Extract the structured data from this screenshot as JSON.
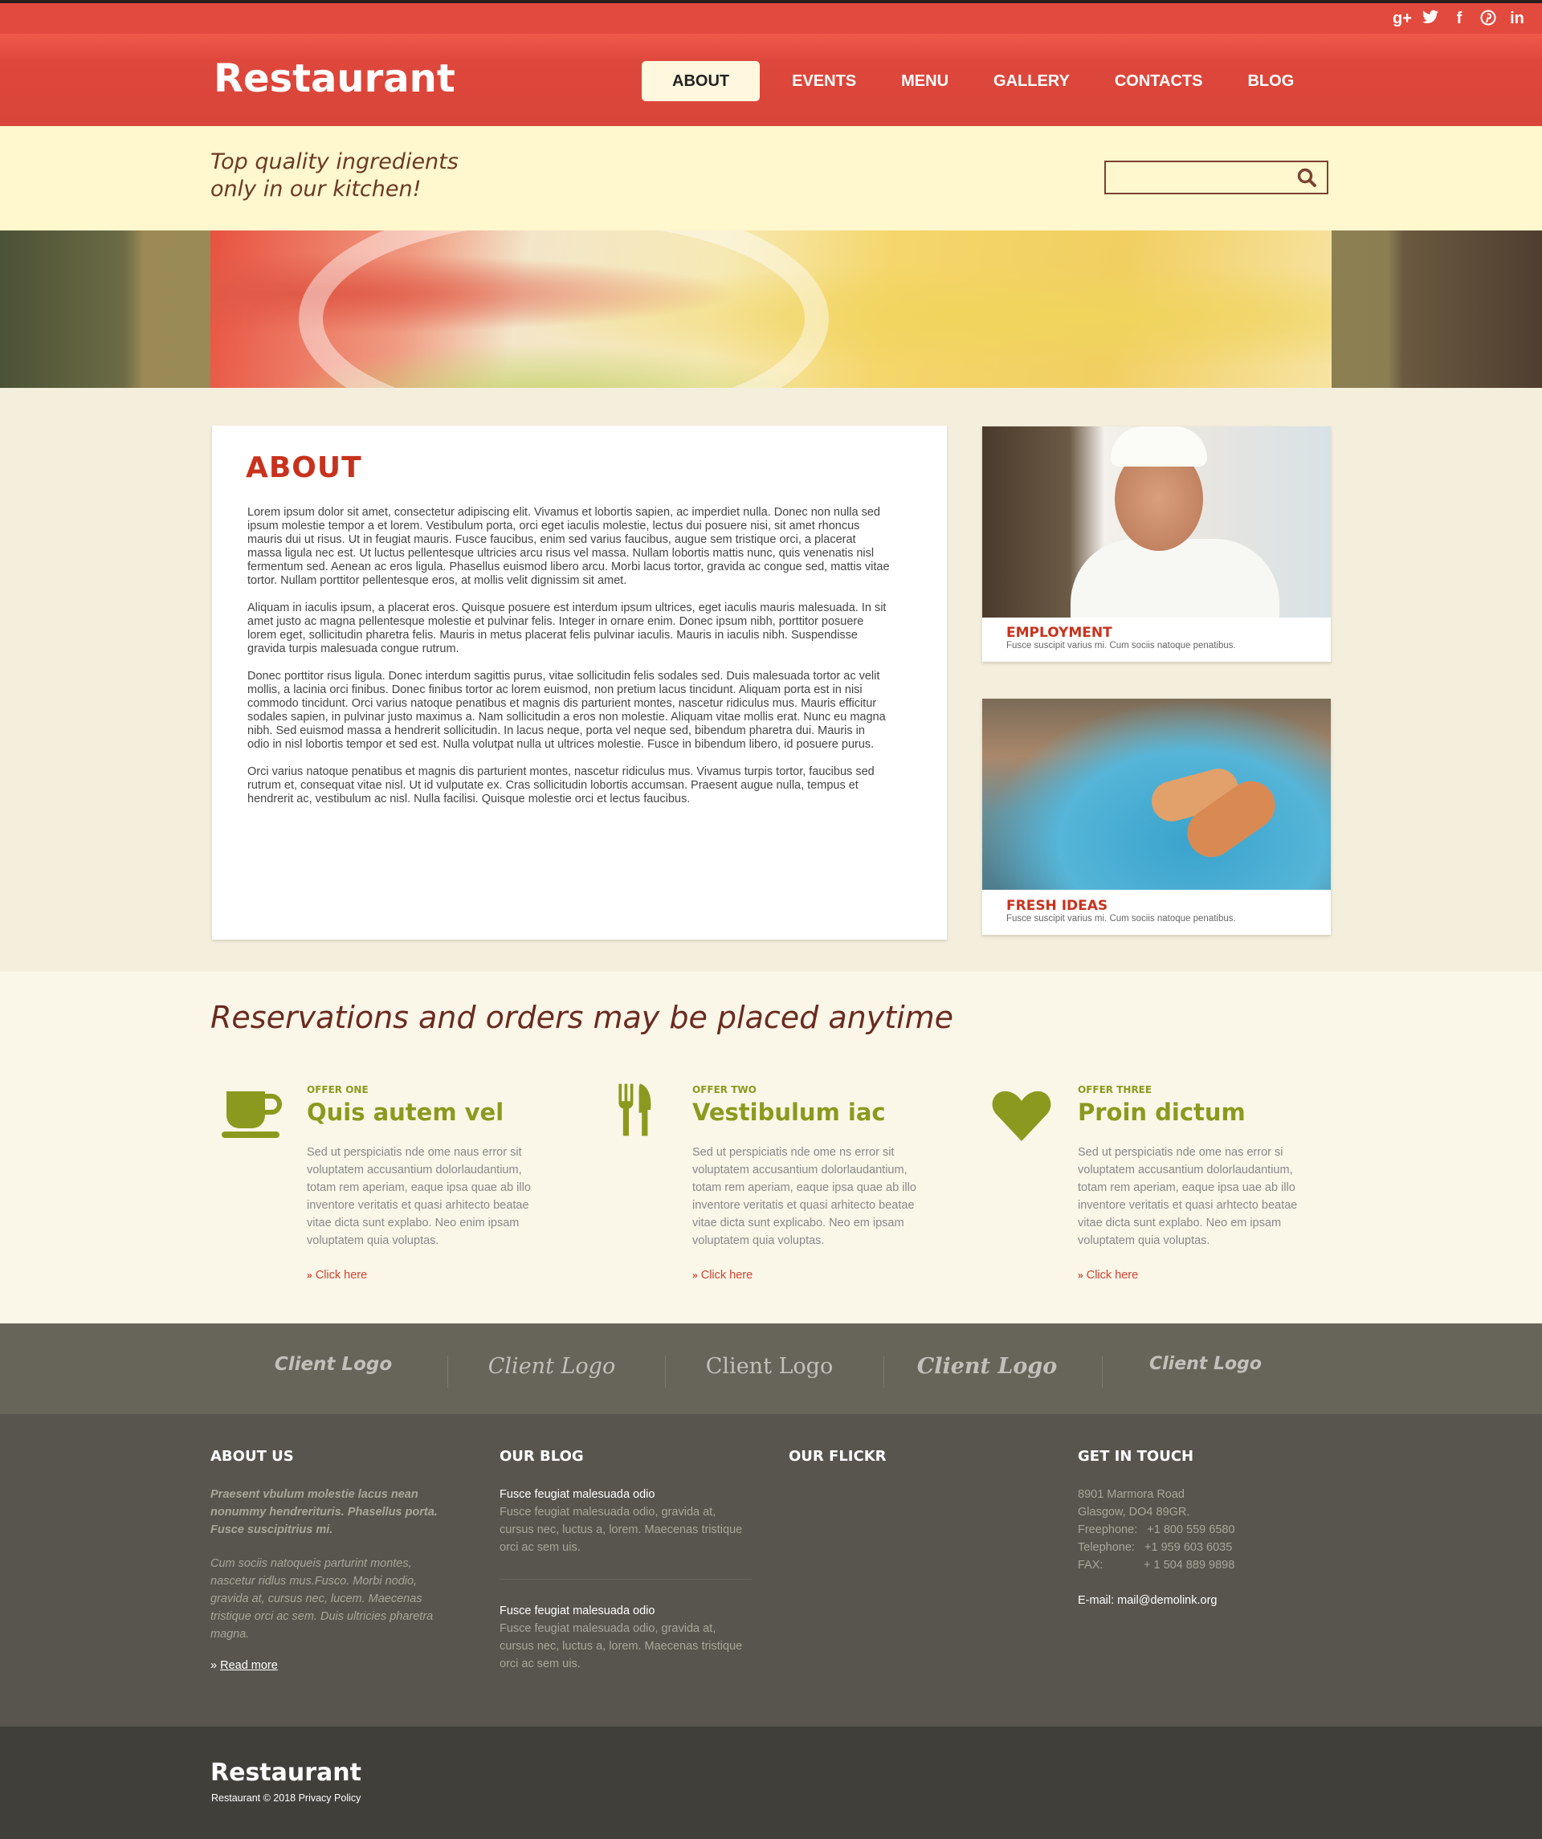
{
  "social": {
    "icons": [
      "google-plus-icon",
      "twitter-icon",
      "facebook-icon",
      "pinterest-icon",
      "linkedin-icon"
    ],
    "glyphs": [
      "g+",
      "t",
      "f",
      "p",
      "in"
    ]
  },
  "brand": {
    "logo": "Restaurant"
  },
  "nav": {
    "items": [
      "ABOUT",
      "EVENTS",
      "MENU",
      "GALLERY",
      "CONTACTS",
      "BLOG"
    ],
    "active": "ABOUT"
  },
  "tagline": {
    "line1": "Top quality ingredients",
    "line2": "only in our kitchen!"
  },
  "search": {
    "placeholder": "",
    "value": "",
    "icon": "search-icon"
  },
  "about": {
    "title": "ABOUT",
    "paragraphs": [
      "Lorem ipsum dolor sit amet, consectetur adipiscing elit. Vivamus et lobortis sapien, ac imperdiet nulla. Donec non nulla sed ipsum molestie tempor a et lorem. Vestibulum porta, orci eget iaculis molestie, lectus dui posuere nisi, sit amet rhoncus mauris dui ut risus. Ut in feugiat mauris. Fusce faucibus, enim sed varius faucibus, augue sem tristique orci, a placerat massa ligula nec est. Ut luctus pellentesque ultricies arcu risus vel massa. Nullam lobortis mattis nunc, quis venenatis nisl fermentum sed. Aenean ac eros ligula. Phasellus euismod libero arcu. Morbi lacus tortor, gravida ac congue sed, mattis vitae tortor. Nullam porttitor pellentesque eros, at mollis velit dignissim sit amet.",
      "Aliquam in iaculis ipsum, a placerat eros. Quisque posuere est interdum ipsum ultrices, eget iaculis mauris malesuada. In sit amet justo ac magna pellentesque molestie et pulvinar felis. Integer in ornare enim. Donec ipsum nibh, porttitor posuere lorem eget, sollicitudin pharetra felis. Mauris in metus placerat felis pulvinar iaculis. Mauris in iaculis nibh. Suspendisse gravida turpis malesuada congue rutrum.",
      "Donec porttitor risus ligula. Donec interdum sagittis purus, vitae sollicitudin felis sodales sed. Duis malesuada tortor ac velit mollis, a lacinia orci finibus. Donec finibus tortor ac lorem euismod, non pretium lacus tincidunt. Aliquam porta est in nisi commodo tincidunt. Orci varius natoque penatibus et magnis dis parturient montes, nascetur ridiculus mus. Mauris efficitur sodales sapien, in pulvinar justo maximus a. Nam sollicitudin a eros non molestie. Aliquam vitae mollis erat. Nunc eu magna nibh. Sed euismod massa a hendrerit sollicitudin. In lacus neque, porta vel neque sed, bibendum pharetra dui. Mauris in odio in nisl lobortis tempor et sed est. Nulla volutpat nulla ut ultrices molestie. Fusce in bibendum libero, id posuere purus.",
      "Orci varius natoque penatibus et magnis dis parturient montes, nascetur ridiculus mus. Vivamus turpis tortor, faucibus sed rutrum et, consequat vitae nisl. Ut id vulputate ex. Cras sollicitudin lobortis accumsan. Praesent augue nulla, tempus et hendrerit ac, vestibulum ac nisl. Nulla facilisi. Quisque molestie orci et lectus faucibus."
    ]
  },
  "side_cards": [
    {
      "title": "EMPLOYMENT",
      "text": "Fusce suscipit varius mi. Cum sociis natoque penatibus."
    },
    {
      "title": "FRESH IDEAS",
      "text": "Fusce suscipit varius mi. Cum sociis natoque penatibus."
    }
  ],
  "reservations": {
    "title": "Reservations and orders may be placed anytime",
    "offers": [
      {
        "kicker": "OFFER ONE",
        "title": "Quis autem vel",
        "icon": "coffee-cup-icon",
        "text": "Sed ut perspiciatis nde ome naus error sit voluptatem accusantium dolorlaudantium, totam rem aperiam, eaque ipsa quae ab illo inventore veritatis et quasi arhitecto beatae vitae dicta sunt explabo. Neo enim ipsam voluptatem quia voluptas.",
        "link": "Click here"
      },
      {
        "kicker": "OFFER TWO",
        "title": "Vestibulum iac",
        "icon": "fork-knife-icon",
        "text": "Sed ut perspiciatis nde ome ns error sit voluptatem accusantium dolorlaudantium, totam rem aperiam, eaque ipsa quae ab illo inventore veritatis et quasi arhitecto beatae vitae dicta sunt explicabo. Neo em ipsam voluptatem quia voluptas.",
        "link": "Click here"
      },
      {
        "kicker": "OFFER THREE",
        "title": "Proin dictum",
        "icon": "heart-icon",
        "text": "Sed ut perspiciatis nde ome nas error si voluptatem accusantium dolorlaudantium, totam rem aperiam, eaque ipsa uae ab illo inventore veritatis et quasi arhtecto beatae vitae dicta sunt explabo. Neo em ipsam voluptatem quia voluptas.",
        "link": "Click here"
      }
    ]
  },
  "clients": [
    "Client Logo",
    "Client Logo",
    "Client Logo",
    "Client Logo",
    "Client Logo"
  ],
  "footer": {
    "about": {
      "title": "ABOUT US",
      "lead": "Praesent vbulum molestie lacus nean nonummy hendrerituris. Phasellus porta. Fusce suscipitrius mi.",
      "text": "Cum sociis natoqueis parturint montes, nascetur ridlus mus.Fusco. Morbi nodio, gravida at, cursus nec, lucem. Maecenas tristique orci ac sem. Duis ultricies pharetra magna.",
      "link": "Read more"
    },
    "blog": {
      "title": "OUR BLOG",
      "posts": [
        {
          "title": "Fusce feugiat malesuada odio",
          "text": "Fusce feugiat malesuada odio, gravida at, cursus nec, luctus a, lorem. Maecenas tristique orci ac sem uis."
        },
        {
          "title": "Fusce feugiat malesuada odio",
          "text": "Fusce feugiat malesuada odio, gravida at, cursus nec, luctus a, lorem. Maecenas tristique orci ac sem uis."
        }
      ]
    },
    "flickr": {
      "title": "OUR FLICKR"
    },
    "contact": {
      "title": "GET IN TOUCH",
      "address1": "8901 Marmora Road",
      "address2": "Glasgow, DO4 89GR.",
      "freephone_label": "Freephone:",
      "freephone": "+1 800 559 6580",
      "telephone_label": "Telephone:",
      "telephone": "+1 959 603 6035",
      "fax_label": "FAX:",
      "fax": "+ 1 504 889 9898",
      "email_label": "E-mail:",
      "email": "mail@demolink.org"
    }
  },
  "bottom": {
    "logo": "Restaurant",
    "copyright": "Restaurant © 2018 Privacy Policy"
  },
  "colors": {
    "primary": "#e24a3e",
    "accent": "#8b9a1e",
    "title_red": "#c8321d",
    "cream": "#fff7cd"
  }
}
